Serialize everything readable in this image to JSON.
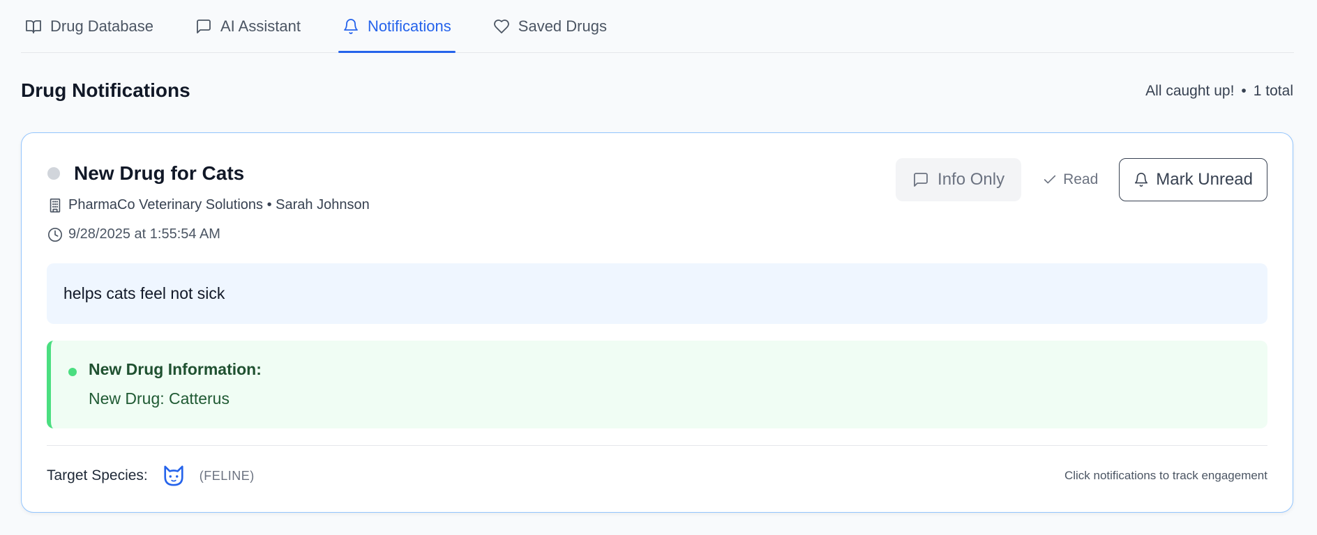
{
  "tabs": [
    {
      "label": "Drug Database",
      "icon": "book-open-icon",
      "active": false
    },
    {
      "label": "AI Assistant",
      "icon": "message-square-icon",
      "active": false
    },
    {
      "label": "Notifications",
      "icon": "bell-icon",
      "active": true
    },
    {
      "label": "Saved Drugs",
      "icon": "heart-icon",
      "active": false
    }
  ],
  "header": {
    "title": "Drug Notifications",
    "status": "All caught up!",
    "separator": "•",
    "total": "1 total"
  },
  "notification": {
    "title": "New Drug for Cats",
    "company_line": "PharmaCo Veterinary Solutions • Sarah Johnson",
    "timestamp": "9/28/2025 at 1:55:54 AM",
    "message": "helps cats feel not sick",
    "info_label": "New Drug Information:",
    "info_value": "New Drug: Catterus",
    "target_species_label": "Target Species:",
    "species_code": "(FELINE)",
    "species_icon": "cat-icon",
    "footer_hint": "Click notifications to track engagement"
  },
  "actions": {
    "info_only": "Info Only",
    "read": "Read",
    "mark_unread": "Mark Unread"
  },
  "colors": {
    "accent": "#2563eb",
    "message_bg": "#eff6ff",
    "info_bg": "#f0fdf4",
    "info_border": "#4ade80",
    "card_border": "#93c5fd"
  }
}
